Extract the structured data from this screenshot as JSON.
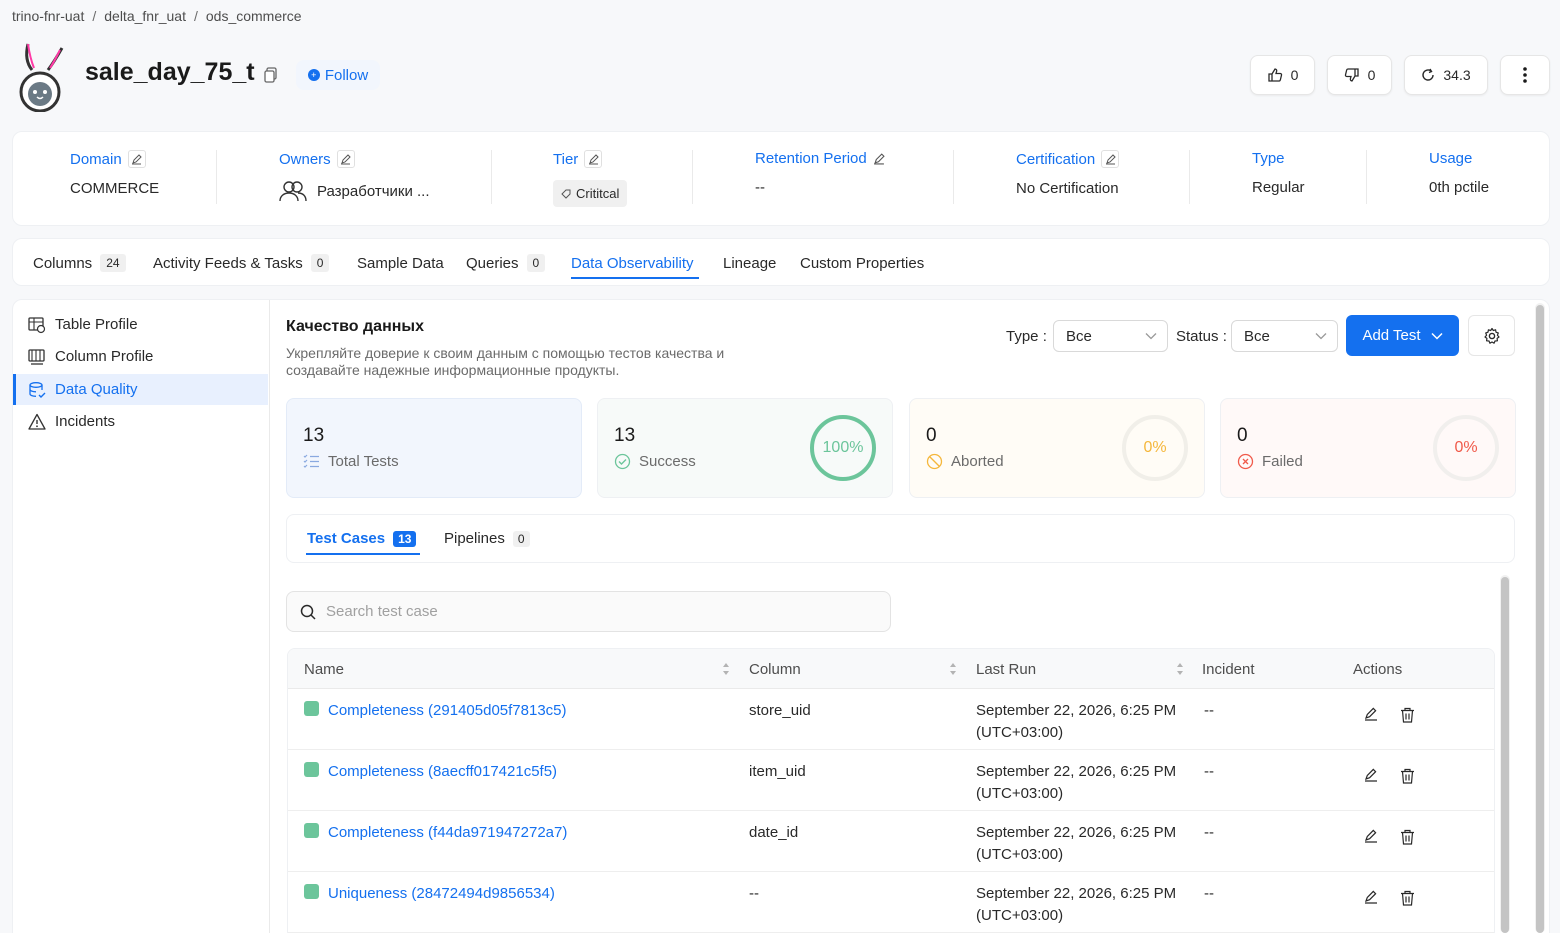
{
  "breadcrumb": [
    "trino-fnr-uat",
    "delta_fnr_uat",
    "ods_commerce"
  ],
  "entity": {
    "name": "sale_day_75_t",
    "follow_label": "Follow"
  },
  "header_actions": {
    "likes": "0",
    "dislikes": "0",
    "version": "34.3"
  },
  "info": {
    "domain": {
      "label": "Domain",
      "value": "COMMERCE"
    },
    "owners": {
      "label": "Owners",
      "value": "Разработчики ..."
    },
    "tier": {
      "label": "Tier",
      "value": "Crititcal"
    },
    "retention": {
      "label": "Retention Period",
      "value": "--"
    },
    "certification": {
      "label": "Certification",
      "value": "No Certification"
    },
    "type": {
      "label": "Type",
      "value": "Regular"
    },
    "usage": {
      "label": "Usage",
      "value": "0th pctile"
    }
  },
  "tabs": [
    {
      "label": "Columns",
      "count": "24"
    },
    {
      "label": "Activity Feeds & Tasks",
      "count": "0"
    },
    {
      "label": "Sample Data"
    },
    {
      "label": "Queries",
      "count": "0"
    },
    {
      "label": "Data Observability",
      "active": true
    },
    {
      "label": "Lineage"
    },
    {
      "label": "Custom Properties"
    }
  ],
  "sidebar": [
    {
      "label": "Table Profile"
    },
    {
      "label": "Column Profile"
    },
    {
      "label": "Data Quality",
      "active": true
    },
    {
      "label": "Incidents"
    }
  ],
  "dq": {
    "title": "Качество данных",
    "description": "Укрепляйте доверие к своим данным с помощью тестов качества и создавайте надежные информационные продукты.",
    "type_label": "Type",
    "type_value": "Все",
    "status_label": "Status",
    "status_value": "Все",
    "add_test_label": "Add Test"
  },
  "stats": [
    {
      "value": "13",
      "label": "Total Tests"
    },
    {
      "value": "13",
      "label": "Success",
      "percent": "100%",
      "fraction": 1.0,
      "color": "#6cc59b"
    },
    {
      "value": "0",
      "label": "Aborted",
      "percent": "0%",
      "fraction": 0.0,
      "color": "#f5b73c"
    },
    {
      "value": "0",
      "label": "Failed",
      "percent": "0%",
      "fraction": 0.0,
      "color": "#f05a4a"
    }
  ],
  "subtabs": [
    {
      "label": "Test Cases",
      "count": "13",
      "active": true
    },
    {
      "label": "Pipelines",
      "count": "0"
    }
  ],
  "search": {
    "placeholder": "Search test case"
  },
  "table": {
    "headers": {
      "name": "Name",
      "column": "Column",
      "last_run": "Last Run",
      "incident": "Incident",
      "actions": "Actions"
    },
    "rows": [
      {
        "name": "Completeness (291405d05f7813c5)",
        "column": "store_uid",
        "last_run_1": "September 22, 2026, 6:25 PM",
        "last_run_2": "(UTC+03:00)",
        "incident": "--"
      },
      {
        "name": "Completeness (8aecff017421c5f5)",
        "column": "item_uid",
        "last_run_1": "September 22, 2026, 6:25 PM",
        "last_run_2": "(UTC+03:00)",
        "incident": "--"
      },
      {
        "name": "Completeness (f44da971947272a7)",
        "column": "date_id",
        "last_run_1": "September 22, 2026, 6:25 PM",
        "last_run_2": "(UTC+03:00)",
        "incident": "--"
      },
      {
        "name": "Uniqueness (28472494d9856534)",
        "column": "--",
        "last_run_1": "September 22, 2026, 6:25 PM",
        "last_run_2": "(UTC+03:00)",
        "incident": "--"
      }
    ]
  }
}
